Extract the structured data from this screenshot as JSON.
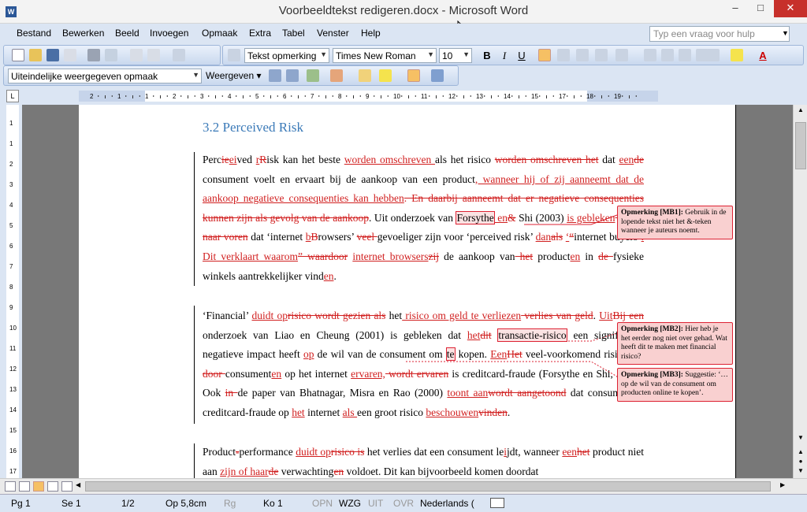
{
  "window": {
    "title": "Voorbeeldtekst redigeren.docx - Microsoft Word",
    "minimize": "–",
    "maximize": "□",
    "close": "✕",
    "app_icon": "W"
  },
  "menu": [
    "Bestand",
    "Bewerken",
    "Beeld",
    "Invoegen",
    "Opmaak",
    "Extra",
    "Tabel",
    "Venster",
    "Help"
  ],
  "help_placeholder": "Typ een vraag voor hulp",
  "toolbar": {
    "style": "Tekst opmerking",
    "font": "Times New Roman",
    "size": "10",
    "bold": "B",
    "italic": "I",
    "underline": "U",
    "font_color_letter": "A"
  },
  "review": {
    "display": "Uiteindelijke weergegeven opmaak",
    "show": "Weergeven"
  },
  "ruler": {
    "ticks": [
      "2",
      "1",
      "1",
      "2",
      "3",
      "4",
      "5",
      "6",
      "7",
      "8",
      "9",
      "10",
      "11",
      "12",
      "13",
      "14",
      "15",
      "17",
      "18",
      "19"
    ],
    "tab_selector": "L",
    "vticks": [
      "1",
      "1",
      "2",
      "3",
      "4",
      "5",
      "6",
      "7",
      "8",
      "9",
      "10",
      "11",
      "12",
      "13",
      "14",
      "15",
      "16",
      "17"
    ]
  },
  "document": {
    "heading": "3.2 Perceived Risk",
    "comments": [
      {
        "label": "Opmerking [MB1]:",
        "text": "Gebruik in de lopende tekst niet het &-teken wanneer je auteurs noemt."
      },
      {
        "label": "Opmerking [MB2]:",
        "text": "Hier heb je het eerder nog niet over gehad. Wat heeft dit te maken met financial risico?"
      },
      {
        "label": "Opmerking [MB3]:",
        "text": "Suggestie: ‘…op de wil van de consument om producten online te kopen’."
      }
    ],
    "p1": {
      "t1": "Perc",
      "d1": "ie",
      "i1": "ei",
      "t2": "ved ",
      "i2": "r",
      "d2": "R",
      "t3": "isk kan het beste ",
      "i3": "worden omschreven ",
      "t4": "als het risico ",
      "d3": "worden omschreven het",
      "t5": " dat ",
      "i4": "een",
      "d4": "de",
      "t6": " consument voelt en ervaart bij de aankoop van een product",
      "i5": ", wanneer hij of zij aanneemt dat de aankoop negatieve consequenties kan hebben",
      "d5": ". En daarbij aanneemt dat er negatieve consequenties kunnen zijn als gevolg van de aankoop",
      "t7": ". Uit onderzoek van ",
      "t8": "Forsythe",
      "i6": " en",
      "d6": "&",
      "t9": " Shi (2003) ",
      "i7": "is gebleken",
      "d7": " kwam naar voren",
      "t10": " dat ‘internet ",
      "i8": "b",
      "d8": "B",
      "t11": "rowsers’ ",
      "d9": "veel ",
      "t12": "gevoeliger zijn voor ‘perceived risk’ ",
      "i9": "dan",
      "d10": "als",
      "t13": " ",
      "i10": "‘",
      "d11": "“",
      "t14": "internet buyers’",
      "i11": ". Dit verklaart waarom",
      "d12": "” waardoor",
      "t15": " ",
      "i12": "internet browsers",
      "d13": "zij",
      "t16": " de aankoop van",
      "d14": " het",
      "t17": " product",
      "i13": "en",
      "t18": " in ",
      "d15": "de ",
      "t19": "fysieke winkels aantrekkelijker vind",
      "i14": "en",
      "t20": "."
    },
    "p2": {
      "t1": "‘Financial’ ",
      "i1": "duidt op",
      "d1": "risico wordt gezien als",
      "t2": " het",
      "i2": " risico om geld te verliezen",
      "d2": " verlies van geld",
      "t3": ". ",
      "i3": "Uit",
      "d3": "Bij een",
      "t4": " onderzoek van Liao en Cheung (2001) is gebleken dat ",
      "i4": "het",
      "d4": "dit",
      "t5": " ",
      "t6": "transactie-risico",
      "t7": " een significante negatieve impact heeft ",
      "i5": "op",
      "t8": " de wil van de consument om ",
      "t9": "te",
      "t10": " kopen. ",
      "i6": "Een",
      "d5": "Het",
      "t11": " veel-voorkomend risico dat ",
      "d6": " door ",
      "t12": "consument",
      "i7": "en",
      "t13": " op het internet ",
      "i8": "ervaren,",
      "d7": " wordt ervaren",
      "t14": " is creditcard-fraude (Forsythe en Shi, 2003). Ook ",
      "d8": "in ",
      "t15": "de paper van Bhatnagar, Misra en Rao (2000) ",
      "i9": "toont aan",
      "d9": "wordt aangetoond",
      "t16": " dat consumenten creditcard-fraude op ",
      "i10": "het",
      "t17": " internet ",
      "i11": "als ",
      "t18": "een groot risico ",
      "i12": "beschouwen",
      "d10": "vinden",
      "t19": "."
    },
    "p3": {
      "t1": "Product",
      "d1": "-",
      "t2": "performance ",
      "i1": "duidt op",
      "d2": "risico is",
      "t3": " het verlies dat een consument le",
      "i2": "i",
      "t4": "jdt, wanneer ",
      "i3": "een",
      "d3": "het",
      "t5": " product niet aan ",
      "i4": "zijn of haar",
      "d4": "de",
      "t6": " verwachting",
      "d5": "en",
      "t7": " voldoet. Dit kan bijvoorbeeld komen doordat"
    }
  },
  "status": {
    "page": "Pg 1",
    "section": "Se 1",
    "pages": "1/2",
    "pos": "Op 5,8cm",
    "row": "Rg",
    "col": "Ko 1",
    "rec": "OPN",
    "trk": "WZG",
    "ext": "UIT",
    "ovr": "OVR",
    "lang": "Nederlands ("
  }
}
